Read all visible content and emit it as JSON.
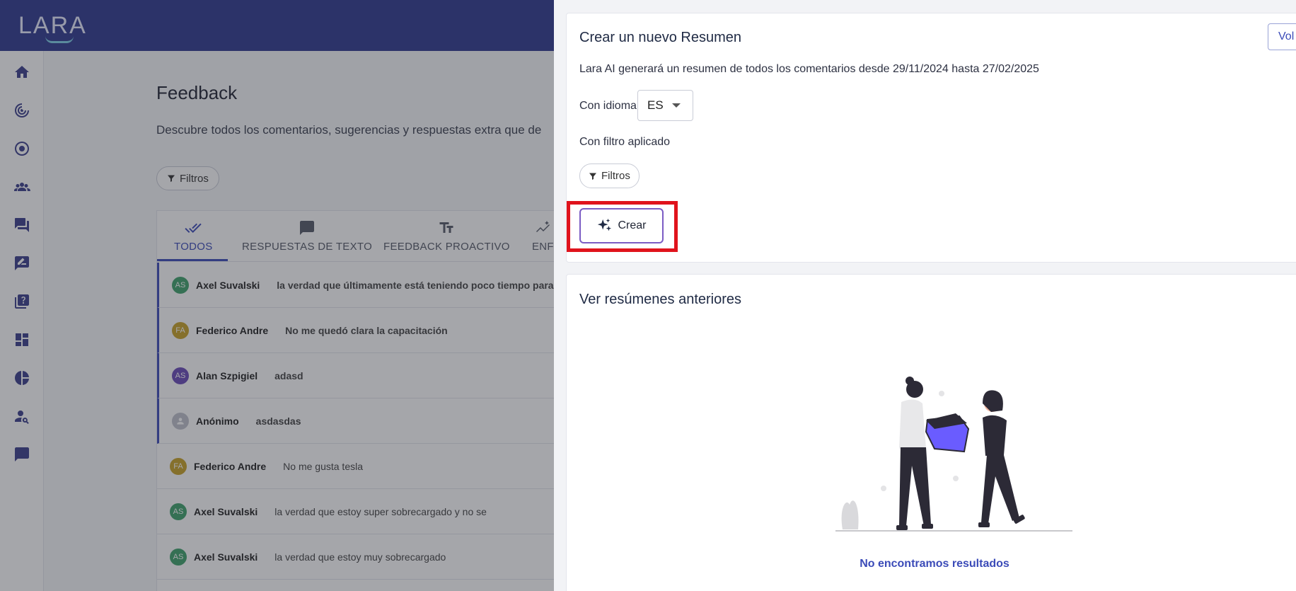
{
  "header": {
    "logo": "LARA"
  },
  "sidebar": {
    "icons": [
      "home-icon",
      "target-icon",
      "radio-icon",
      "team-icon",
      "chat-icon",
      "feedback-icon",
      "help-library-icon",
      "dashboard-icon",
      "pie-chart-icon",
      "user-search-icon",
      "message-icon"
    ]
  },
  "main": {
    "title": "Feedback",
    "subtitle": "Descubre todos los comentarios, sugerencias y respuestas extra que de",
    "filter_label": "Filtros",
    "tabs": [
      {
        "label": "TODOS",
        "icon": "double-check-icon"
      },
      {
        "label": "RESPUESTAS DE TEXTO",
        "icon": "comment-icon"
      },
      {
        "label": "FEEDBACK PROACTIVO",
        "icon": "text-format-icon"
      },
      {
        "label": "ENF",
        "icon": "sparkle-line-icon"
      }
    ],
    "rows": [
      {
        "initials": "AS",
        "color": "#3fa36b",
        "author": "Axel Suvalski",
        "comment": "la verdad que últimamente está teniendo poco tiempo para mi",
        "unread": true
      },
      {
        "initials": "FA",
        "color": "#c9a227",
        "author": "Federico Andre",
        "comment": "No me quedó clara la capacitación",
        "unread": true
      },
      {
        "initials": "AS",
        "color": "#6a4bb8",
        "author": "Alan Szpigiel",
        "comment": "adasd",
        "unread": true
      },
      {
        "initials": "",
        "color": "#bfc2cc",
        "author": "Anónimo",
        "comment": "asdasdas",
        "unread": true
      },
      {
        "initials": "FA",
        "color": "#c9a227",
        "author": "Federico Andre",
        "comment": "No me gusta tesla",
        "unread": false
      },
      {
        "initials": "AS",
        "color": "#3fa36b",
        "author": "Axel Suvalski",
        "comment": "la verdad que estoy super sobrecargado y no se",
        "unread": false
      },
      {
        "initials": "AS",
        "color": "#3fa36b",
        "author": "Axel Suvalski",
        "comment": "la verdad que estoy muy sobrecargado",
        "unread": false
      }
    ]
  },
  "drawer": {
    "create": {
      "title": "Crear un nuevo Resumen",
      "back_label": "Vol",
      "info": "Lara AI generará un resumen de todos los comentarios desde 29/11/2024 hasta 27/02/2025",
      "language_label": "Con idioma",
      "language_value": "ES",
      "filter_applied_label": "Con filtro aplicado",
      "filter_button": "Filtros",
      "create_button": "Crear"
    },
    "previous": {
      "title": "Ver resúmenes anteriores",
      "empty_message": "No encontramos resultados"
    }
  },
  "colors": {
    "brand": "#2f3a8f",
    "accent": "#3b4bb8",
    "highlight": "#e0131c"
  }
}
